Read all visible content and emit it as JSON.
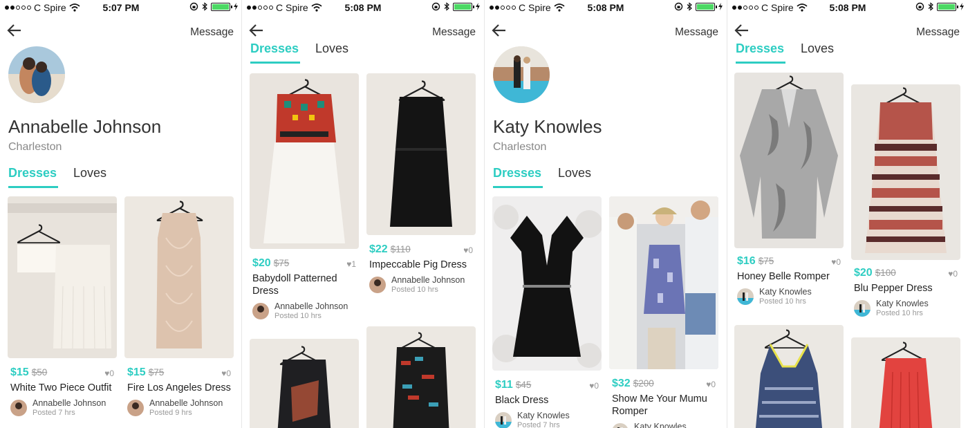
{
  "colors": {
    "accent": "#2dcdc2",
    "text": "#222222",
    "muted": "#999999"
  },
  "status": {
    "carrier": "C Spire",
    "battery_level": 1.0
  },
  "screens": [
    {
      "time": "5:07 PM",
      "back_icon": "back-arrow-icon",
      "message_label": "Message",
      "profile": {
        "name": "Annabelle Johnson",
        "location": "Charleston"
      },
      "tabs": [
        "Dresses",
        "Loves"
      ],
      "items": [
        {
          "price": "$15",
          "original_price": "$50",
          "likes": "♥0",
          "title": "White Two Piece Outfit",
          "seller": "Annabelle Johnson",
          "posted": "Posted 7 hrs"
        },
        {
          "price": "$15",
          "original_price": "$75",
          "likes": "♥0",
          "title": "Fire Los Angeles Dress",
          "seller": "Annabelle Johnson",
          "posted": "Posted 9 hrs"
        }
      ]
    },
    {
      "time": "5:08 PM",
      "back_icon": "back-arrow-icon",
      "message_label": "Message",
      "tabs": [
        "Dresses",
        "Loves"
      ],
      "items": [
        {
          "price": "$20",
          "original_price": "$75",
          "likes": "♥1",
          "title": "Babydoll Patterned Dress",
          "seller": "Annabelle Johnson",
          "posted": "Posted 10 hrs"
        },
        {
          "price": "$22",
          "original_price": "$110",
          "likes": "♥0",
          "title": "Impeccable Pig Dress",
          "seller": "Annabelle Johnson",
          "posted": "Posted 10 hrs"
        }
      ]
    },
    {
      "time": "5:08 PM",
      "back_icon": "back-arrow-icon",
      "message_label": "Message",
      "profile": {
        "name": "Katy Knowles",
        "location": "Charleston"
      },
      "tabs": [
        "Dresses",
        "Loves"
      ],
      "items": [
        {
          "price": "$11",
          "original_price": "$45",
          "likes": "♥0",
          "title": "Black Dress",
          "seller": "Katy Knowles",
          "posted": "Posted 7 hrs"
        },
        {
          "price": "$32",
          "original_price": "$200",
          "likes": "♥0",
          "title": "Show Me Your Mumu Romper",
          "seller": "Katy Knowles",
          "posted": ""
        }
      ]
    },
    {
      "time": "5:08 PM",
      "back_icon": "back-arrow-icon",
      "message_label": "Message",
      "tabs": [
        "Dresses",
        "Loves"
      ],
      "items": [
        {
          "price": "$16",
          "original_price": "$75",
          "likes": "♥0",
          "title": "Honey Belle Romper",
          "seller": "Katy Knowles",
          "posted": "Posted 10 hrs"
        },
        {
          "price": "$20",
          "original_price": "$100",
          "likes": "♥0",
          "title": "Blu Pepper Dress",
          "seller": "Katy Knowles",
          "posted": "Posted 10 hrs"
        }
      ]
    }
  ]
}
